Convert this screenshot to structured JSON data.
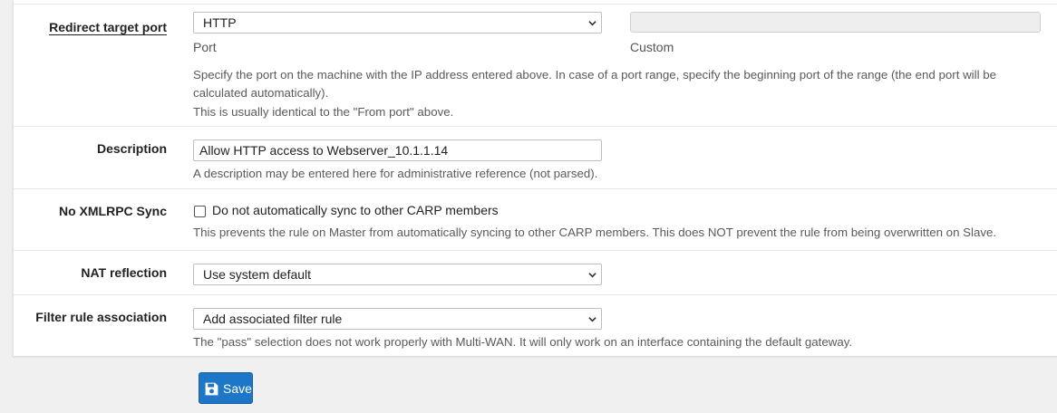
{
  "redirect_port": {
    "label": "Redirect target port",
    "port_value": "HTTP",
    "port_sublabel": "Port",
    "custom_value": "",
    "custom_sublabel": "Custom",
    "help_line1": "Specify the port on the machine with the IP address entered above. In case of a port range, specify the beginning port of the range (the end port will be",
    "help_line2": "calculated automatically).",
    "help_line3": "This is usually identical to the \"From port\" above."
  },
  "description": {
    "label": "Description",
    "value": "Allow HTTP access to Webserver_10.1.1.14",
    "help": "A description may be entered here for administrative reference (not parsed)."
  },
  "xmlrpc": {
    "label": "No XMLRPC Sync",
    "checked": false,
    "checkbox_label": "Do not automatically sync to other CARP members",
    "help": "This prevents the rule on Master from automatically syncing to other CARP members. This does NOT prevent the rule from being overwritten on Slave."
  },
  "nat_reflection": {
    "label": "NAT reflection",
    "value": "Use system default"
  },
  "filter_rule": {
    "label": "Filter rule association",
    "value": "Add associated filter rule",
    "help": "The \"pass\" selection does not work properly with Multi-WAN. It will only work on an interface containing the default gateway."
  },
  "save": {
    "label": "Save",
    "icon": "floppy-disk-icon",
    "color": "#1e76c6"
  }
}
